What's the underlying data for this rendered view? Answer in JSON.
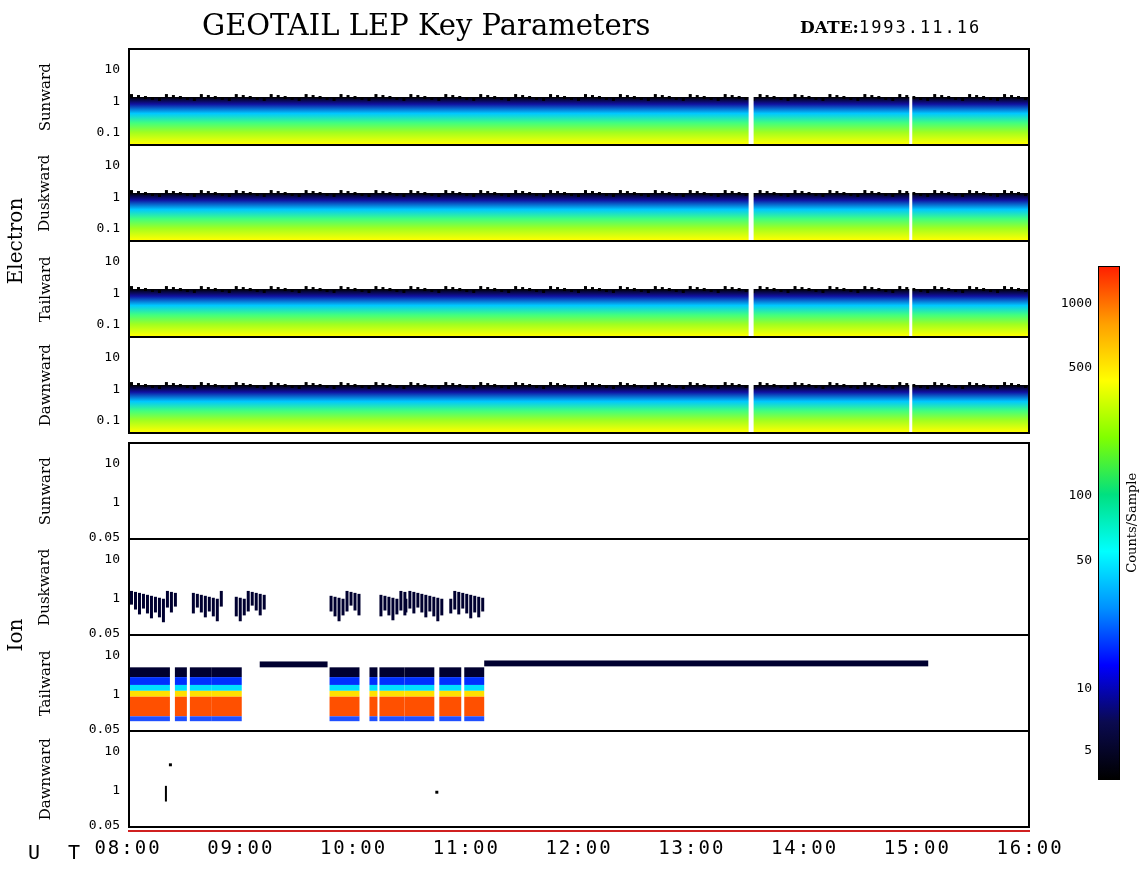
{
  "title": "GEOTAIL LEP Key Parameters",
  "date": {
    "label": "DATE:",
    "value": "1993.11.16"
  },
  "groups": [
    {
      "label": "Electron",
      "panels": [
        {
          "label": "Sunward",
          "kind": "band",
          "yticks": [
            "10",
            "1",
            "0.1"
          ]
        },
        {
          "label": "Duskward",
          "kind": "band",
          "yticks": [
            "10",
            "1",
            "0.1"
          ]
        },
        {
          "label": "Tailward",
          "kind": "band",
          "yticks": [
            "10",
            "1",
            "0.1"
          ]
        },
        {
          "label": "Dawnward",
          "kind": "band",
          "yticks": [
            "10",
            "1",
            "0.1"
          ]
        }
      ]
    },
    {
      "label": "Ion",
      "panels": [
        {
          "label": "Sunward",
          "kind": "empty",
          "yticks": [
            "10",
            "1",
            "0.05"
          ]
        },
        {
          "label": "Duskward",
          "kind": "speckle",
          "yticks": [
            "10",
            "1",
            "0.05"
          ]
        },
        {
          "label": "Tailward",
          "kind": "blocks",
          "yticks": [
            "10",
            "1",
            "0.05"
          ]
        },
        {
          "label": "Dawnward",
          "kind": "dots",
          "yticks": [
            "10",
            "1",
            "0.05"
          ]
        }
      ]
    }
  ],
  "x_axis": {
    "label": "U T",
    "ticks": [
      "08:00",
      "09:00",
      "10:00",
      "11:00",
      "12:00",
      "13:00",
      "14:00",
      "15:00",
      "16:00"
    ]
  },
  "colorbar": {
    "title": "Counts/Sample",
    "ticks": [
      "1000",
      "500",
      "100",
      "50",
      "10",
      "5"
    ]
  }
}
